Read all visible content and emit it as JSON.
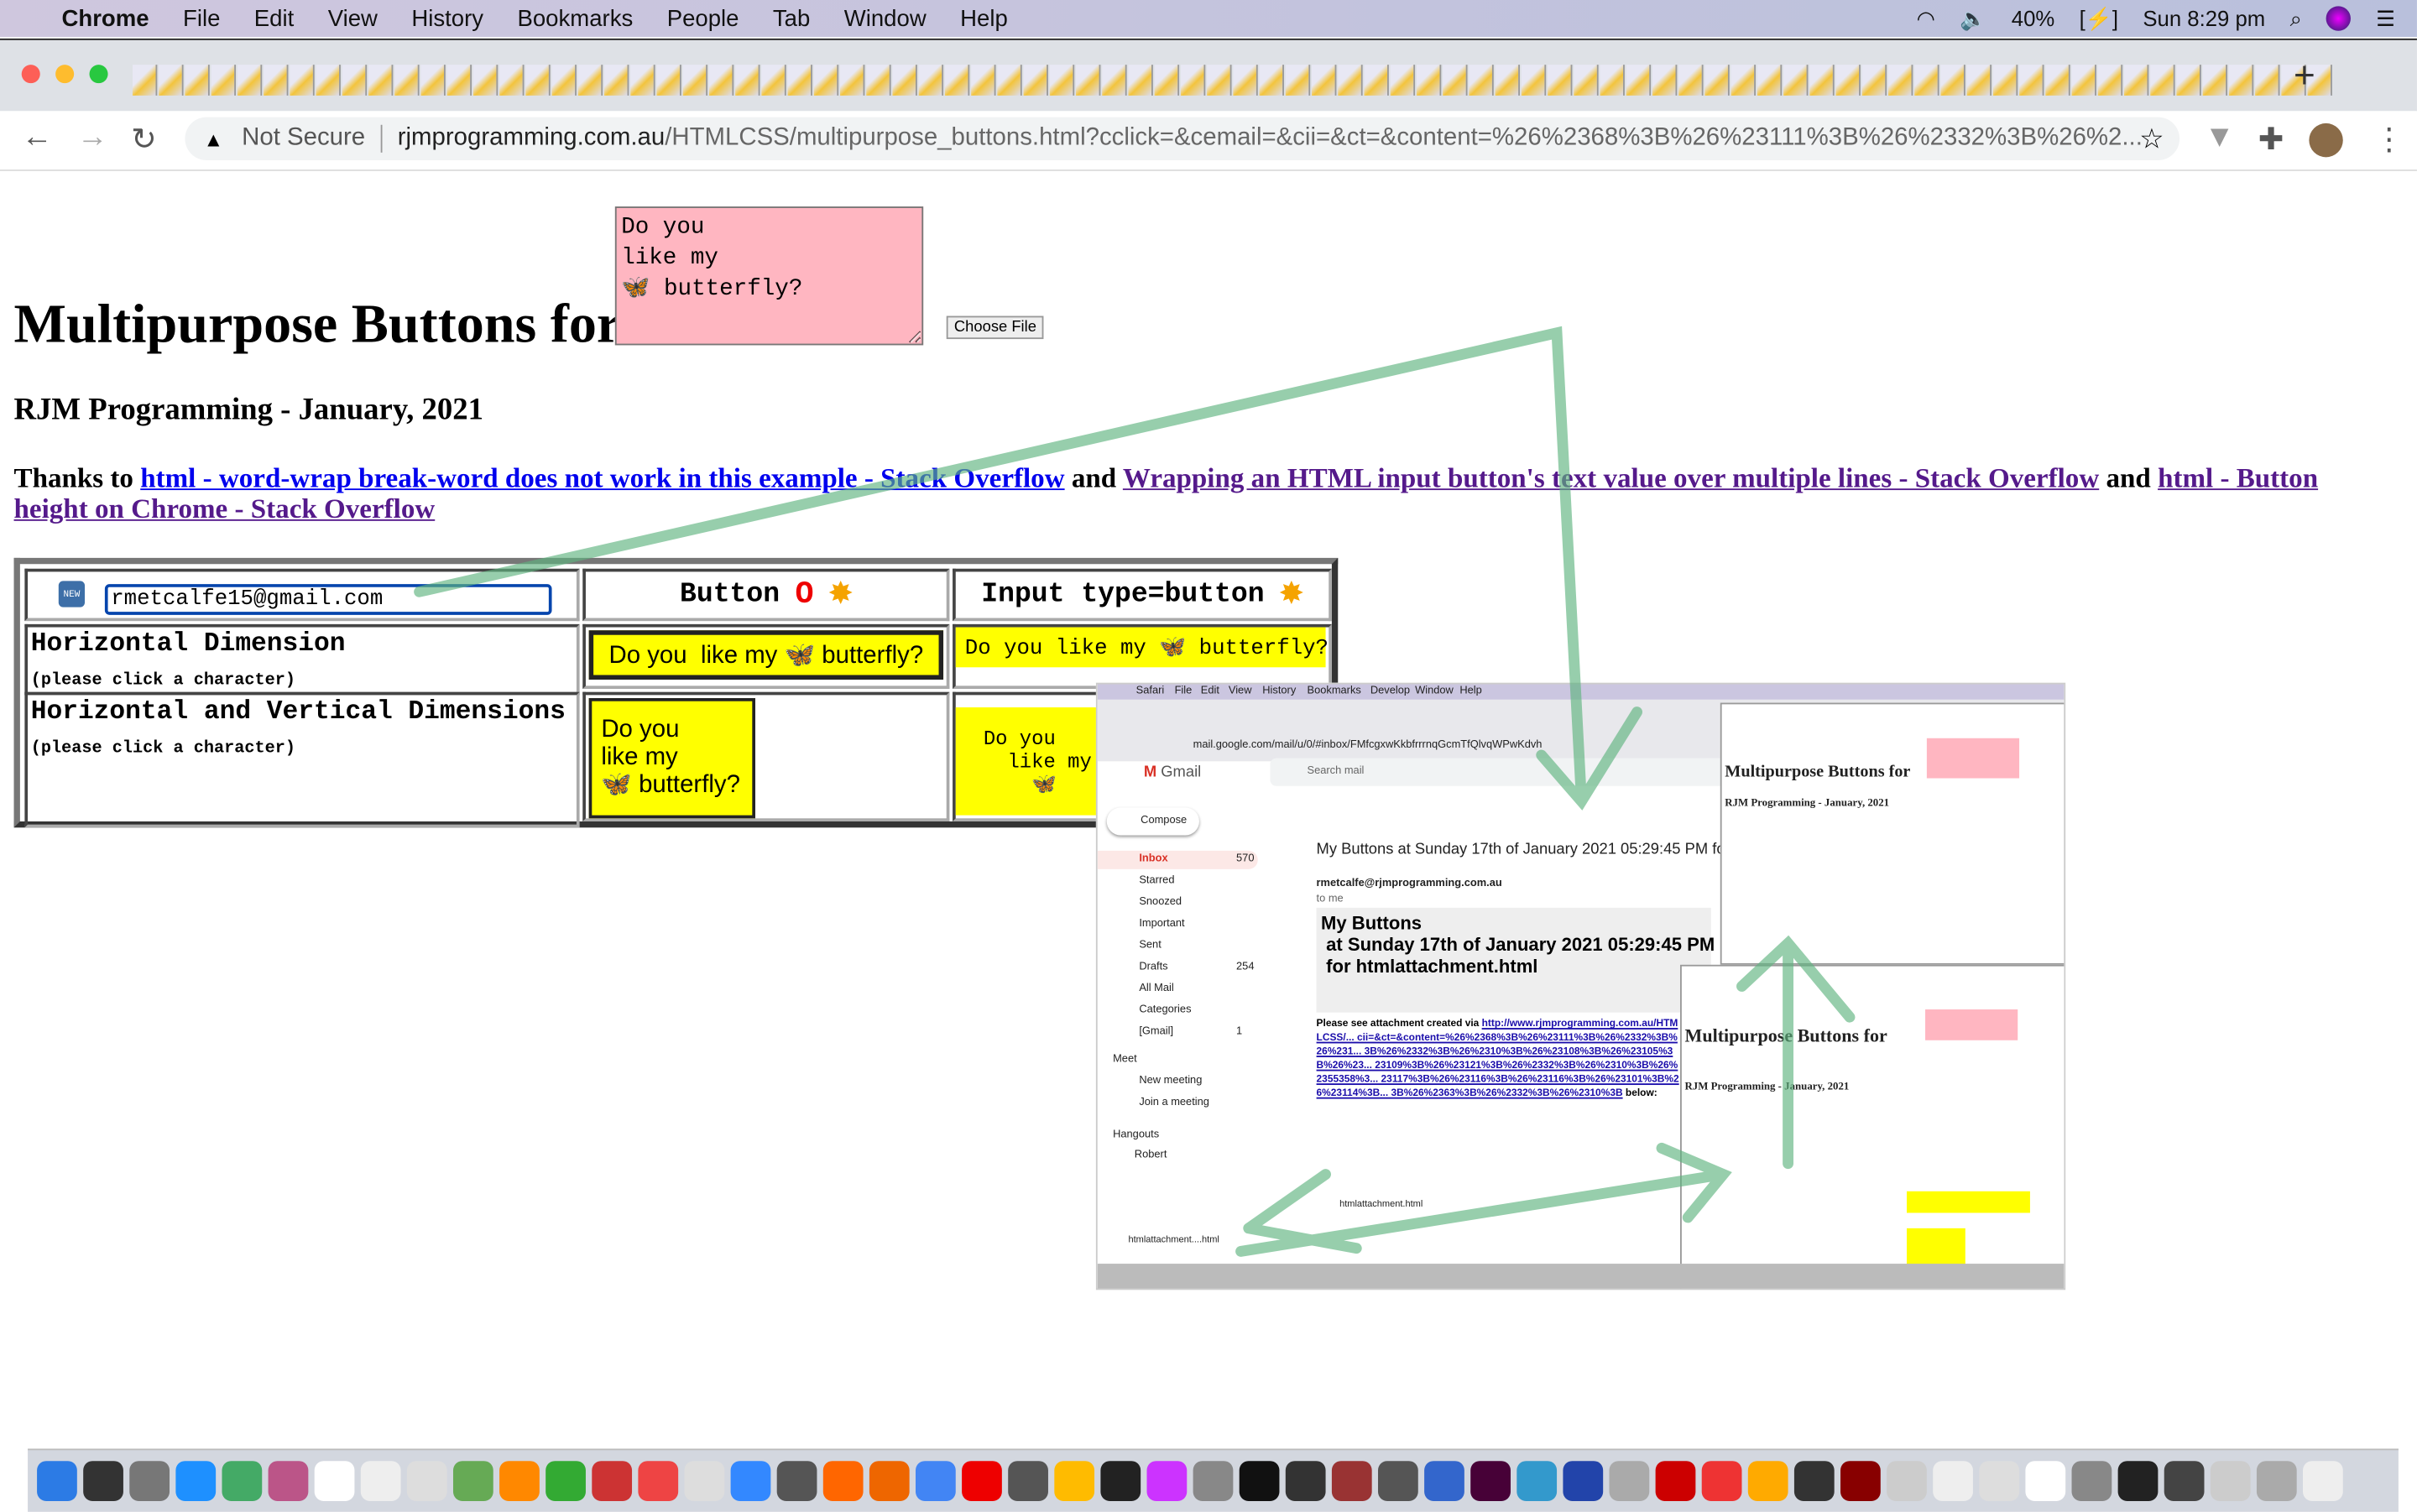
{
  "menubar": {
    "app": "Chrome",
    "items": [
      "File",
      "Edit",
      "View",
      "History",
      "Bookmarks",
      "People",
      "Tab",
      "Window",
      "Help"
    ],
    "battery": "40%",
    "clock": "Sun 8:29 pm"
  },
  "toolbar": {
    "security": "Not Secure",
    "host": "rjmprogramming.com.au",
    "path": "/HTMLCSS/multipurpose_buttons.html?cclick=&cemail=&cii=&ct=&content=%26%2368%3B%26%23111%3B%26%2332%3B%26%2..."
  },
  "page": {
    "title": "Multipurpose Buttons for",
    "textarea_value": "Do you\nlike my\n🦋 butterfly?",
    "choose_file": "Choose File",
    "subtitle": "RJM Programming - January, 2021",
    "thanks_prefix": "Thanks to ",
    "link1": "html - word-wrap break-word does not work in this example - Stack Overflow",
    "and1": " and ",
    "link2": "Wrapping an HTML input button's text value over multiple lines - Stack Overflow",
    "and2": " and ",
    "link3": "html - Button height on Chrome - Stack Overflow",
    "table": {
      "email_value": "rmetcalfe15@gmail.com",
      "col2": "Button",
      "col3": "Input type=button",
      "row1_title": "Horizontal Dimension",
      "row2_title": "Horizontal and Vertical Dimensions",
      "hint": "(please click a character)",
      "btn_h": "Do you  like my 🦋 butterfly?",
      "input_h": "Do you like my 🦋 butterfly?",
      "btn_v": "Do you\nlike my\n🦋 butterfly?",
      "input_v": "Do you\n  like my\n    🦋"
    }
  },
  "embedded": {
    "menu": [
      "Safari",
      "File",
      "Edit",
      "View",
      "History",
      "Bookmarks",
      "Develop",
      "Window",
      "Help"
    ],
    "url": "mail.google.com/mail/u/0/#inbox/FMfcgxwKkbfrrrnqGcmTfQlvqWPwKdvh",
    "gmail": "Gmail",
    "search": "Search mail",
    "compose": "Compose",
    "labels": [
      {
        "name": "Inbox",
        "count": "570"
      },
      {
        "name": "Starred"
      },
      {
        "name": "Snoozed"
      },
      {
        "name": "Important"
      },
      {
        "name": "Sent"
      },
      {
        "name": "Drafts",
        "count": "254"
      },
      {
        "name": "All Mail"
      },
      {
        "name": "Categories"
      },
      {
        "name": "[Gmail]",
        "count": "1"
      }
    ],
    "meet": "Meet",
    "new_meeting": "New meeting",
    "join": "Join a meeting",
    "hangouts": "Hangouts",
    "user": "Robert",
    "subject": "My Buttons at Sunday 17th of January 2021 05:29:45 PM for h",
    "from": "rmetcalfe@rjmprogramming.com.au",
    "to": "to me",
    "body_title": "My Buttons\n at Sunday 17th of January 2021 05:29:45 PM\n for htmlattachment.html",
    "body_text": "Please see attachment created via ",
    "body_link": "http://www.rjmprogramming.com.au/HTMLCSS/... cii=&ct=&content=%26%2368%3B%26%23111%3B%26%2332%3B%26%231... 3B%26%2332%3B%26%2310%3B%26%23108%3B%26%23105%3B%26%23... 23109%3B%26%23121%3B%26%2332%3B%26%2310%3B%26%2355358%3... 23117%3B%26%23116%3B%26%23116%3B%26%23101%3B%26%23114%3B... 3B%26%2363%3B%26%2332%3B%26%2310%3B",
    "below": " below:",
    "attachment": "htmlattachment.html",
    "download": "htmlattachment....html",
    "mini_title": "Multipurpose Buttons for",
    "mini_sub": "RJM Programming - January, 2021"
  },
  "colors": {
    "accent_link": "#0000ee",
    "button_yellow": "#ffff00",
    "textarea_pink": "#ffb6c1",
    "arrow_green": "#5fb37f"
  }
}
